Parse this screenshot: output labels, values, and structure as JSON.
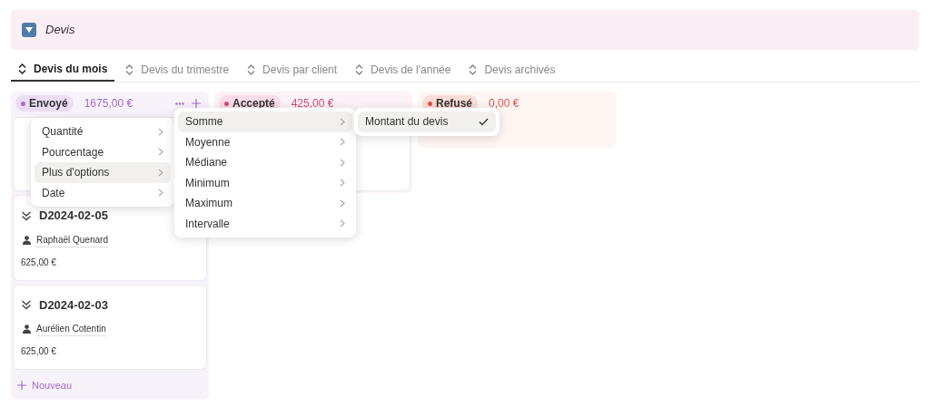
{
  "header": {
    "title": "Devis"
  },
  "tabs": [
    {
      "label": "Devis du mois",
      "selected": true
    },
    {
      "label": "Devis du trimestre",
      "selected": false
    },
    {
      "label": "Devis par client",
      "selected": false
    },
    {
      "label": "Devis de l'année",
      "selected": false
    },
    {
      "label": "Devis archivés",
      "selected": false
    }
  ],
  "columns": [
    {
      "status": "Envoyé",
      "color": "#a36bc9",
      "total": "1675,00 €",
      "actions": true,
      "new_label": "Nouveau",
      "cards": [
        {
          "kind": "covered"
        },
        {
          "kind": "card",
          "title": "D2024-02-05",
          "person": "Raphaël Quenard",
          "amount": "625,00 €"
        },
        {
          "kind": "card",
          "title": "D2024-02-03",
          "person": "Aurélien Cotentin",
          "amount": "625,00 €"
        }
      ]
    },
    {
      "status": "Accepté",
      "color": "#d9487a",
      "total": "425,00 €",
      "actions": false,
      "cards": [
        {
          "kind": "covered"
        }
      ]
    },
    {
      "status": "Refusé",
      "color": "#e0524a",
      "total": "0,00 €",
      "actions": false
    }
  ],
  "menus": [
    {
      "items": [
        {
          "label": "Quantité",
          "selected": false,
          "submenu": true
        },
        {
          "label": "Pourcentage",
          "selected": false,
          "submenu": true
        },
        {
          "label": "Plus d'options",
          "selected": true,
          "submenu": true
        },
        {
          "label": "Date",
          "selected": false,
          "submenu": true
        }
      ]
    },
    {
      "items": [
        {
          "label": "Somme",
          "selected": true,
          "submenu": true
        },
        {
          "label": "Moyenne",
          "selected": false,
          "submenu": true
        },
        {
          "label": "Médiane",
          "selected": false,
          "submenu": true
        },
        {
          "label": "Minimum",
          "selected": false,
          "submenu": true
        },
        {
          "label": "Maximum",
          "selected": false,
          "submenu": true
        },
        {
          "label": "Intervalle",
          "selected": false,
          "submenu": true
        }
      ]
    },
    {
      "items": [
        {
          "label": "Montant du devis",
          "selected": true,
          "submenu": false,
          "checked": true
        }
      ]
    }
  ]
}
